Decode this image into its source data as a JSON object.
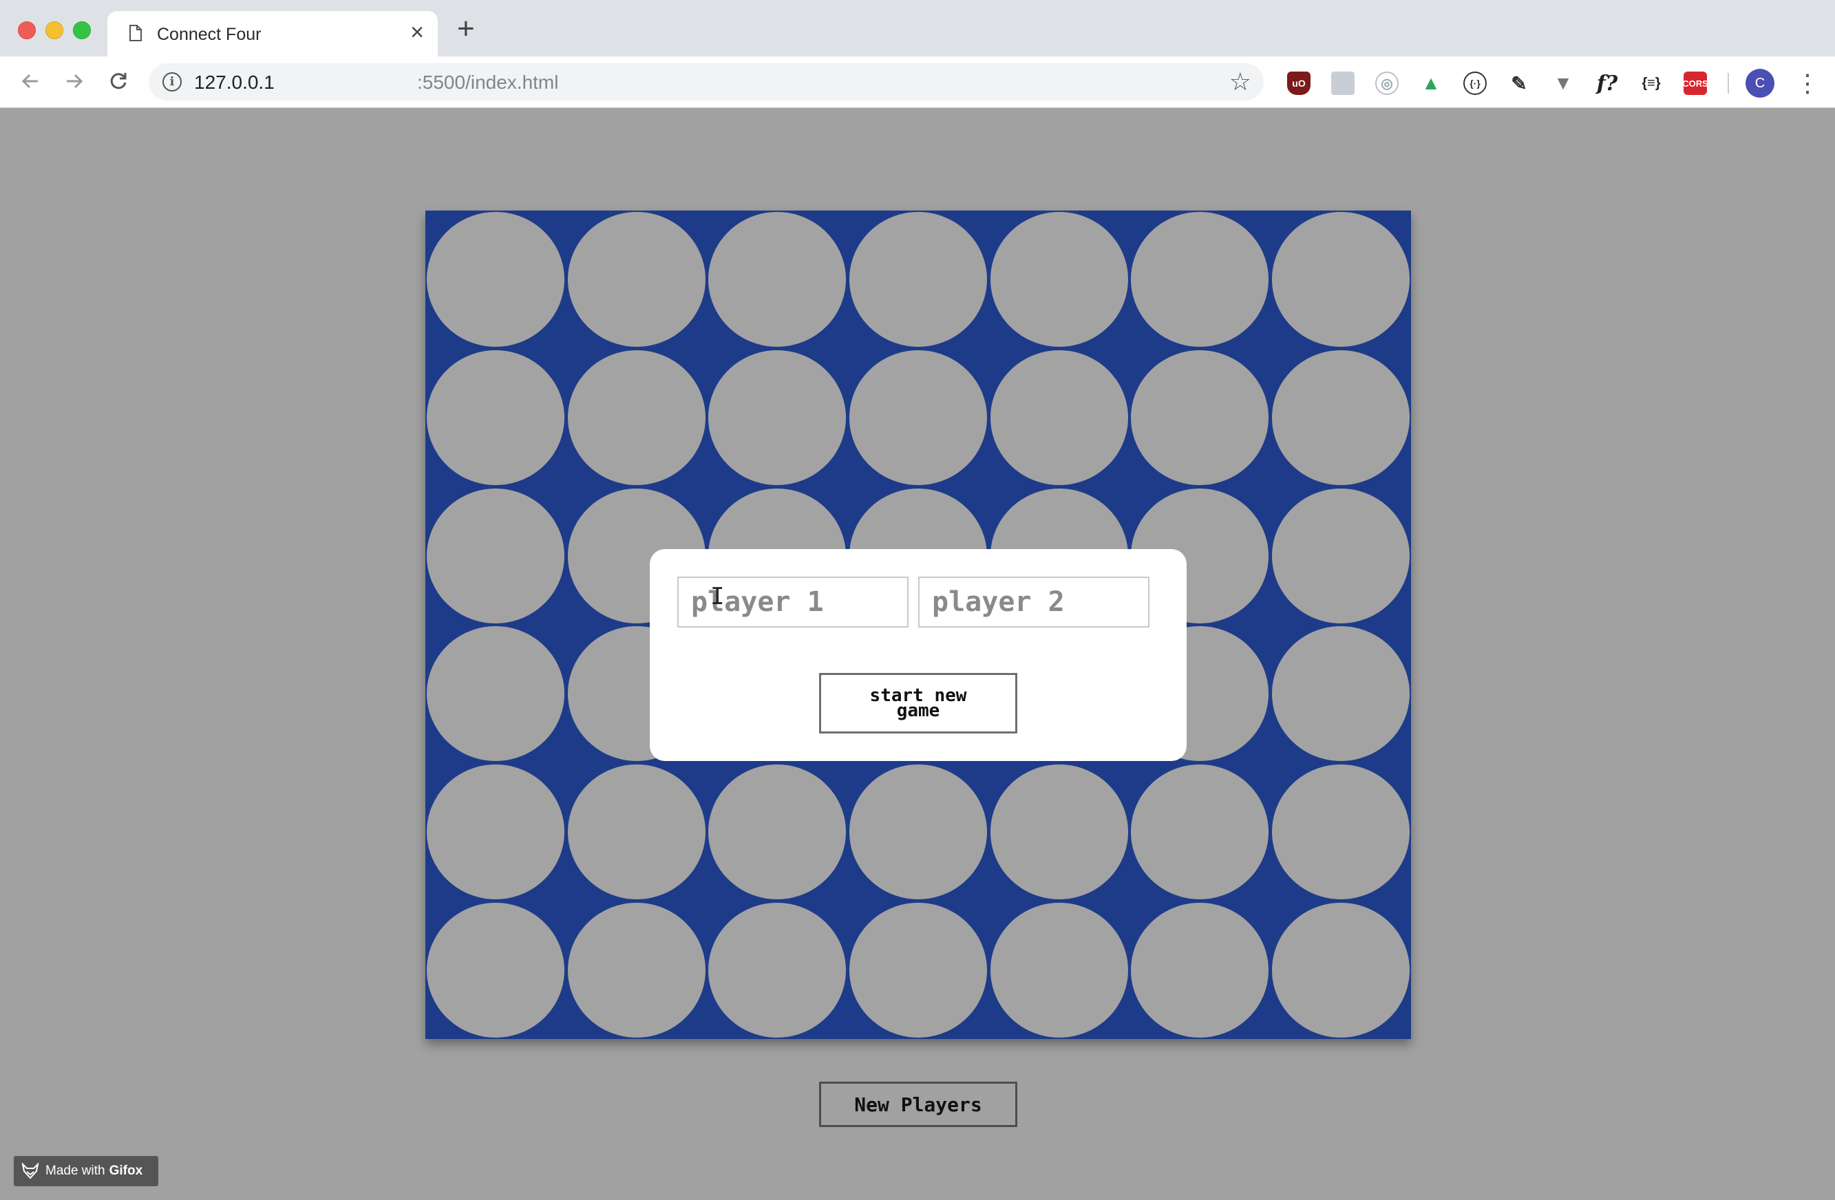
{
  "browser": {
    "tab_title": "Connect Four",
    "tab_close": "×",
    "new_tab": "+",
    "url_host": "127.0.0.1",
    "url_rest": ":5500/index.html",
    "avatar_letter": "C",
    "extensions": [
      "uBlock",
      "grid",
      "react-devtools",
      "vue",
      "json-formatter",
      "eyedropper",
      "vue-devtools",
      "f?",
      "{≡}",
      "CORS"
    ]
  },
  "game": {
    "board_color": "#1d3b88",
    "empty_cell_color": "#a3a3a3",
    "columns": 7,
    "rows": 6
  },
  "modal": {
    "player1_placeholder": "player 1",
    "player2_placeholder": "player 2",
    "start_button": "start new game"
  },
  "page": {
    "new_players_button": "New Players",
    "background_color": "#a1a1a1"
  },
  "gifox": {
    "made_with": "Made with",
    "brand": "Gifox"
  }
}
